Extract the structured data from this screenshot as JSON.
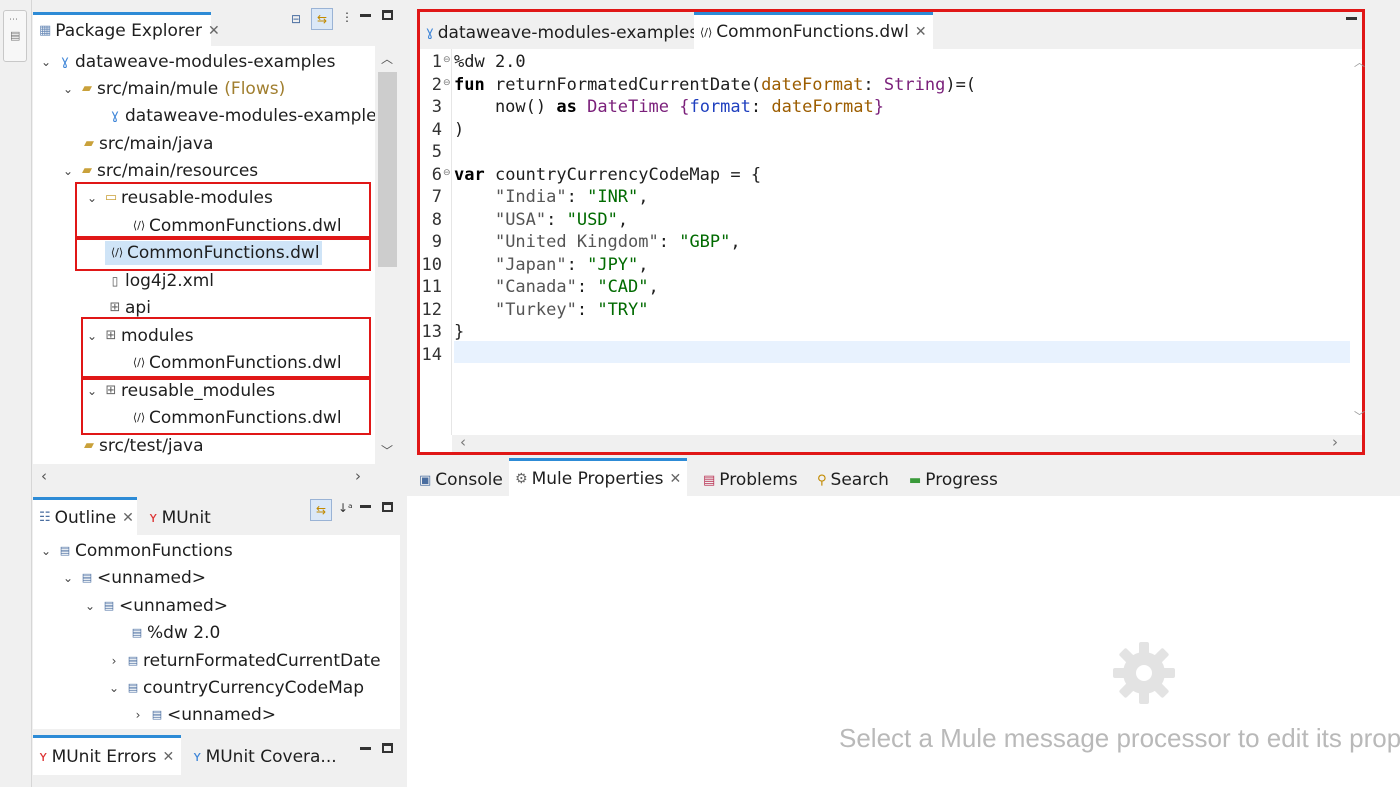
{
  "package_explorer": {
    "tab_label": "Package Explorer",
    "tree": [
      {
        "label": "dataweave-modules-examples",
        "level": 0,
        "icon": "mule-project-icon",
        "twisty": "expanded"
      },
      {
        "label": "src/main/mule",
        "suffix": "(Flows)",
        "level": 1,
        "icon": "source-folder-icon",
        "twisty": "expanded"
      },
      {
        "label": "dataweave-modules-examples.x",
        "level": 2,
        "icon": "mule-file-icon",
        "twisty": "none"
      },
      {
        "label": "src/main/java",
        "level": 1,
        "icon": "package-folder-icon",
        "twisty": "none"
      },
      {
        "label": "src/main/resources",
        "level": 1,
        "icon": "package-folder-icon",
        "twisty": "expanded"
      },
      {
        "label": "reusable-modules",
        "level": 2,
        "icon": "folder-icon",
        "twisty": "expanded"
      },
      {
        "label": "CommonFunctions.dwl",
        "level": 3,
        "icon": "dwl-file-icon",
        "twisty": "none"
      },
      {
        "label": "CommonFunctions.dwl",
        "level": 2,
        "icon": "dwl-file-icon",
        "twisty": "none",
        "selected": true
      },
      {
        "label": "log4j2.xml",
        "level": 2,
        "icon": "xml-file-icon",
        "twisty": "none"
      },
      {
        "label": "api",
        "level": 2,
        "icon": "package-icon",
        "twisty": "none"
      },
      {
        "label": "modules",
        "level": 2,
        "icon": "package-icon",
        "twisty": "expanded"
      },
      {
        "label": "CommonFunctions.dwl",
        "level": 3,
        "icon": "dwl-file-icon",
        "twisty": "none"
      },
      {
        "label": "reusable_modules",
        "level": 2,
        "icon": "package-icon",
        "twisty": "expanded"
      },
      {
        "label": "CommonFunctions.dwl",
        "level": 3,
        "icon": "dwl-file-icon",
        "twisty": "none"
      },
      {
        "label": "src/test/java",
        "level": 1,
        "icon": "package-folder-icon",
        "twisty": "none"
      }
    ]
  },
  "outline": {
    "tab_label": "Outline",
    "munit_tab_label": "MUnit",
    "tree": [
      {
        "label": "CommonFunctions",
        "level": 0,
        "twisty": "expanded"
      },
      {
        "label": "<unnamed>",
        "level": 1,
        "twisty": "expanded"
      },
      {
        "label": "<unnamed>",
        "level": 2,
        "twisty": "expanded"
      },
      {
        "label": "%dw 2.0",
        "level": 3,
        "twisty": "none"
      },
      {
        "label": "returnFormatedCurrentDate",
        "level": 3,
        "twisty": "collapsed"
      },
      {
        "label": "countryCurrencyCodeMap",
        "level": 3,
        "twisty": "expanded"
      },
      {
        "label": "<unnamed>",
        "level": 4,
        "twisty": "collapsed"
      }
    ]
  },
  "munit": {
    "errors_tab_label": "MUnit Errors",
    "coverage_tab_label": "MUnit Covera..."
  },
  "editor": {
    "tabs": [
      {
        "label": "dataweave-modules-examples",
        "active": false
      },
      {
        "label": "CommonFunctions.dwl",
        "active": true
      }
    ],
    "line_numbers": [
      "1",
      "2",
      "3",
      "4",
      "5",
      "6",
      "7",
      "8",
      "9",
      "10",
      "11",
      "12",
      "13",
      "14"
    ],
    "code": {
      "l1": "%dw 2.0",
      "l2_kw": "fun",
      "l2_name": " returnFormatedCurrentDate(",
      "l2_param": "dateFormat",
      "l2_colon": ": ",
      "l2_type": "String",
      "l2_end": ")=(",
      "l3_call": "    now() ",
      "l3_as": "as",
      "l3_space": " ",
      "l3_type": "DateTime",
      "l3_open": " {",
      "l3_key": "format",
      "l3_colon": ": ",
      "l3_param": "dateFormat",
      "l3_close": "}",
      "l4": ")",
      "l6_kw": "var",
      "l6_rest": " countryCurrencyCodeMap = {",
      "entries": [
        {
          "key": "\"India\"",
          "value": "\"INR\"",
          "trail": ","
        },
        {
          "key": "\"USA\"",
          "value": "\"USD\"",
          "trail": ","
        },
        {
          "key": "\"United Kingdom\"",
          "value": "\"GBP\"",
          "trail": ","
        },
        {
          "key": "\"Japan\"",
          "value": "\"JPY\"",
          "trail": ","
        },
        {
          "key": "\"Canada\"",
          "value": "\"CAD\"",
          "trail": ","
        },
        {
          "key": "\"Turkey\"",
          "value": "\"TRY\"",
          "trail": ""
        }
      ],
      "l13": "}"
    }
  },
  "bottom_tabs": [
    {
      "label": "Console",
      "icon": "console-icon"
    },
    {
      "label": "Mule Properties",
      "icon": "mule-properties-icon",
      "active": true
    },
    {
      "label": "Problems",
      "icon": "problems-icon"
    },
    {
      "label": "Search",
      "icon": "search-icon"
    },
    {
      "label": "Progress",
      "icon": "progress-icon"
    }
  ],
  "properties": {
    "hint": "Select a Mule message processor to edit its prope"
  },
  "colors": {
    "highlight_box": "#e01717",
    "active_tab_accent": "#2d8bd6",
    "string_value": "#006a00",
    "parameter": "#9c5d00",
    "type": "#7a1f7a"
  }
}
